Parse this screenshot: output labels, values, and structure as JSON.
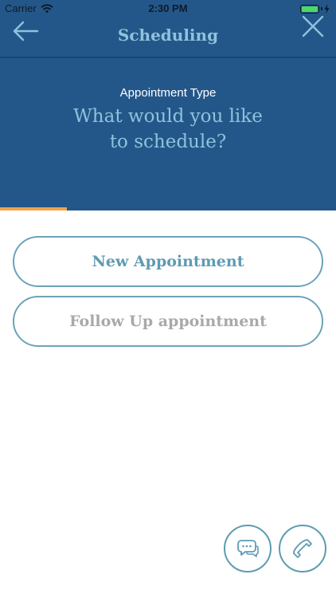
{
  "status_bar": {
    "carrier": "Carrier",
    "time": "2:30 PM",
    "battery_level": 1.0
  },
  "nav": {
    "title": "Scheduling",
    "back_icon": "arrow-left-icon",
    "close_icon": "close-icon"
  },
  "header": {
    "label": "Appointment Type",
    "question_line1": "What would you like",
    "question_line2": "to schedule?"
  },
  "progress": {
    "fraction": 0.2
  },
  "options": [
    {
      "label": "New Appointment"
    },
    {
      "label": "Follow Up appointment"
    }
  ],
  "fabs": {
    "chat_icon": "chat-icon",
    "phone_icon": "phone-icon"
  },
  "colors": {
    "header_bg": "#245789",
    "accent_light_blue": "#8fc2dc",
    "progress": "#f0a34b",
    "button_border": "#6da3b8",
    "button_text_active": "#5e9bb3",
    "button_text_muted": "#a9a9a9"
  }
}
